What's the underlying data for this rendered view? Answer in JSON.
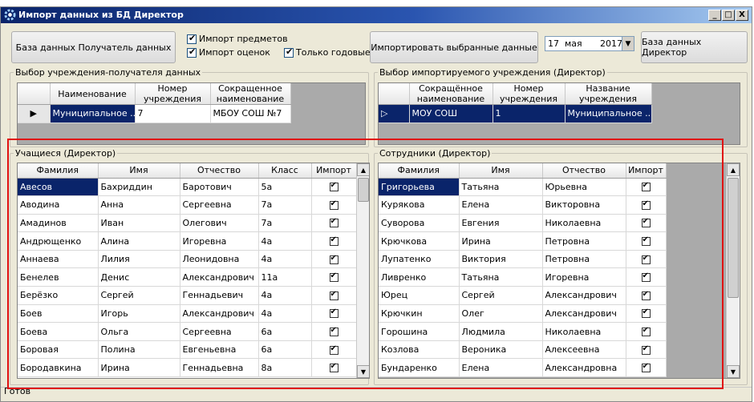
{
  "window": {
    "title": "Импорт данных из БД Директор",
    "controls": [
      "_",
      "□",
      "X"
    ]
  },
  "toolbar": {
    "recipient_db_button": "База данных Получатель данных",
    "import_subjects": "Импорт предметов",
    "import_grades": "Импорт оценок",
    "only_yearly": "Только годовые",
    "import_selected_button": "Импортировать выбранные данные",
    "date": {
      "day": "17",
      "month": "мая",
      "year": "2017",
      "dropdown": "▼"
    },
    "director_db_button": "База данных Директор"
  },
  "recipient_group": {
    "legend": "Выбор учреждения-получателя данных",
    "headers": [
      "Наименование",
      "Номер учреждения",
      "Сокращенное наименование"
    ],
    "row_marker": "▶",
    "row": [
      "Муниципальное ...",
      "7",
      "МБОУ СОШ №7"
    ]
  },
  "source_group": {
    "legend": "Выбор импортируемого учреждения (Директор)",
    "headers": [
      "Сокращённое наименование",
      "Номер учреждения",
      "Название учреждения"
    ],
    "row_marker": "▷",
    "row": [
      "МОУ СОШ",
      "1",
      "Муниципальное ..."
    ]
  },
  "students": {
    "legend": "Учащиеся (Директор)",
    "headers": [
      "Фамилия",
      "Имя",
      "Отчество",
      "Класс",
      "Импорт"
    ],
    "rows": [
      [
        "Авесов",
        "Бахриддин",
        "Баротович",
        "5а"
      ],
      [
        "Аводина",
        "Анна",
        "Сергеевна",
        "7а"
      ],
      [
        "Амадинов",
        "Иван",
        "Олегович",
        "7а"
      ],
      [
        "Андрющенко",
        "Алина",
        "Игоревна",
        "4а"
      ],
      [
        "Аннаева",
        "Лилия",
        "Леонидовна",
        "4а"
      ],
      [
        "Бенелев",
        "Денис",
        "Александрович",
        "11а"
      ],
      [
        "Берёзко",
        "Сергей",
        "Геннадьевич",
        "4а"
      ],
      [
        "Боев",
        "Игорь",
        "Александрович",
        "4а"
      ],
      [
        "Боева",
        "Ольга",
        "Сергеевна",
        "6а"
      ],
      [
        "Боровая",
        "Полина",
        "Евгеньевна",
        "6а"
      ],
      [
        "Бородавкина",
        "Ирина",
        "Геннадьевна",
        "8а"
      ]
    ]
  },
  "staff": {
    "legend": "Сотрудники (Директор)",
    "headers": [
      "Фамилия",
      "Имя",
      "Отчество",
      "Импорт"
    ],
    "rows": [
      [
        "Григорьева",
        "Татьяна",
        "Юрьевна"
      ],
      [
        "Курякова",
        "Елена",
        "Викторовна"
      ],
      [
        "Суворова",
        "Евгения",
        "Николаевна"
      ],
      [
        "Крючкова",
        "Ирина",
        "Петровна"
      ],
      [
        "Лупатенко",
        "Виктория",
        "Петровна"
      ],
      [
        "Ливренко",
        "Татьяна",
        "Игоревна"
      ],
      [
        "Юрец",
        "Сергей",
        "Александрович"
      ],
      [
        "Крючкин",
        "Олег",
        "Александрович"
      ],
      [
        "Горошина",
        "Людмила",
        "Николаевна"
      ],
      [
        "Козлова",
        "Вероника",
        "Алексеевна"
      ],
      [
        "Бундаренко",
        "Елена",
        "Александровна"
      ]
    ]
  },
  "status": {
    "text": "Готов"
  },
  "colors": {
    "selection": "#0a246a",
    "highlight_border": "#e01010"
  }
}
